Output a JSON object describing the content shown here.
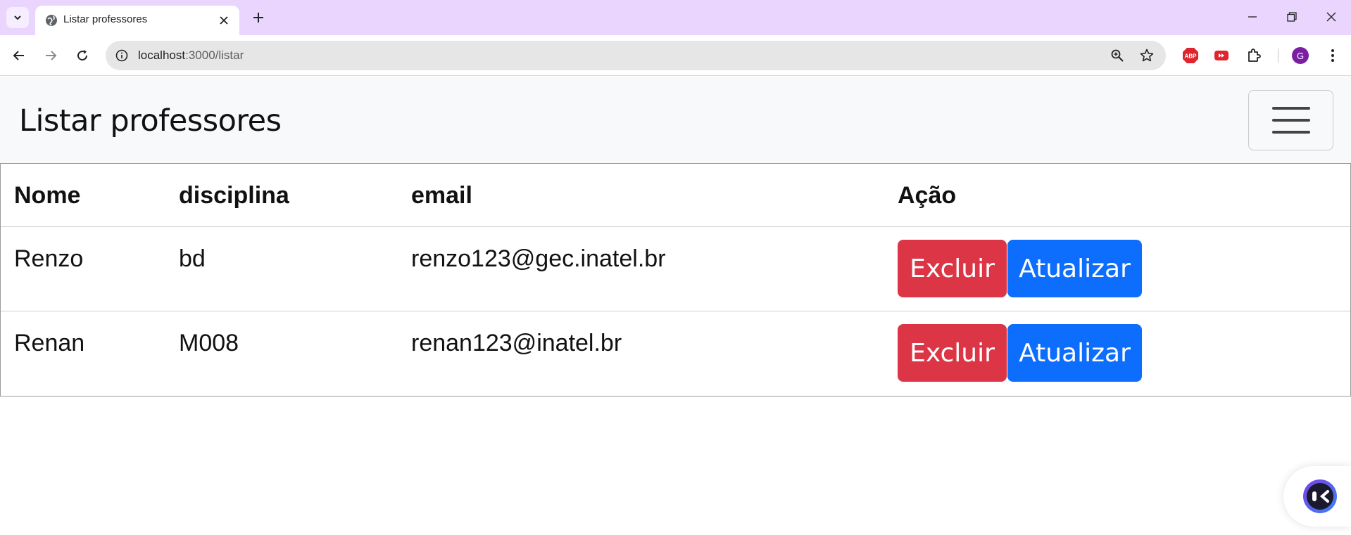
{
  "browser": {
    "tab_title": "Listar professores",
    "url_host": "localhost",
    "url_path": ":3000/listar",
    "profile_initial": "G",
    "accent": "#e9d5fd"
  },
  "page": {
    "brand": "Listar professores",
    "table": {
      "headers": [
        "Nome",
        "disciplina",
        "email",
        "Ação"
      ],
      "rows": [
        {
          "nome": "Renzo",
          "disciplina": "bd",
          "email": "renzo123@gec.inatel.br"
        },
        {
          "nome": "Renan",
          "disciplina": "M008",
          "email": "renan123@inatel.br"
        }
      ],
      "delete_label": "Excluir",
      "update_label": "Atualizar"
    },
    "colors": {
      "danger": "#dc3545",
      "primary": "#0d6efd",
      "navbar_bg": "#f8f9fa"
    }
  },
  "icons": [
    "tab-search-icon",
    "globe-icon",
    "close-icon",
    "plus-icon",
    "minimize-icon",
    "restore-icon",
    "back-icon",
    "forward-icon",
    "reload-icon",
    "info-icon",
    "zoom-icon",
    "star-icon",
    "adblock-icon",
    "youtube-ext-icon",
    "extensions-icon",
    "avatar",
    "menu-icon",
    "hamburger-icon",
    "assistant-icon"
  ]
}
